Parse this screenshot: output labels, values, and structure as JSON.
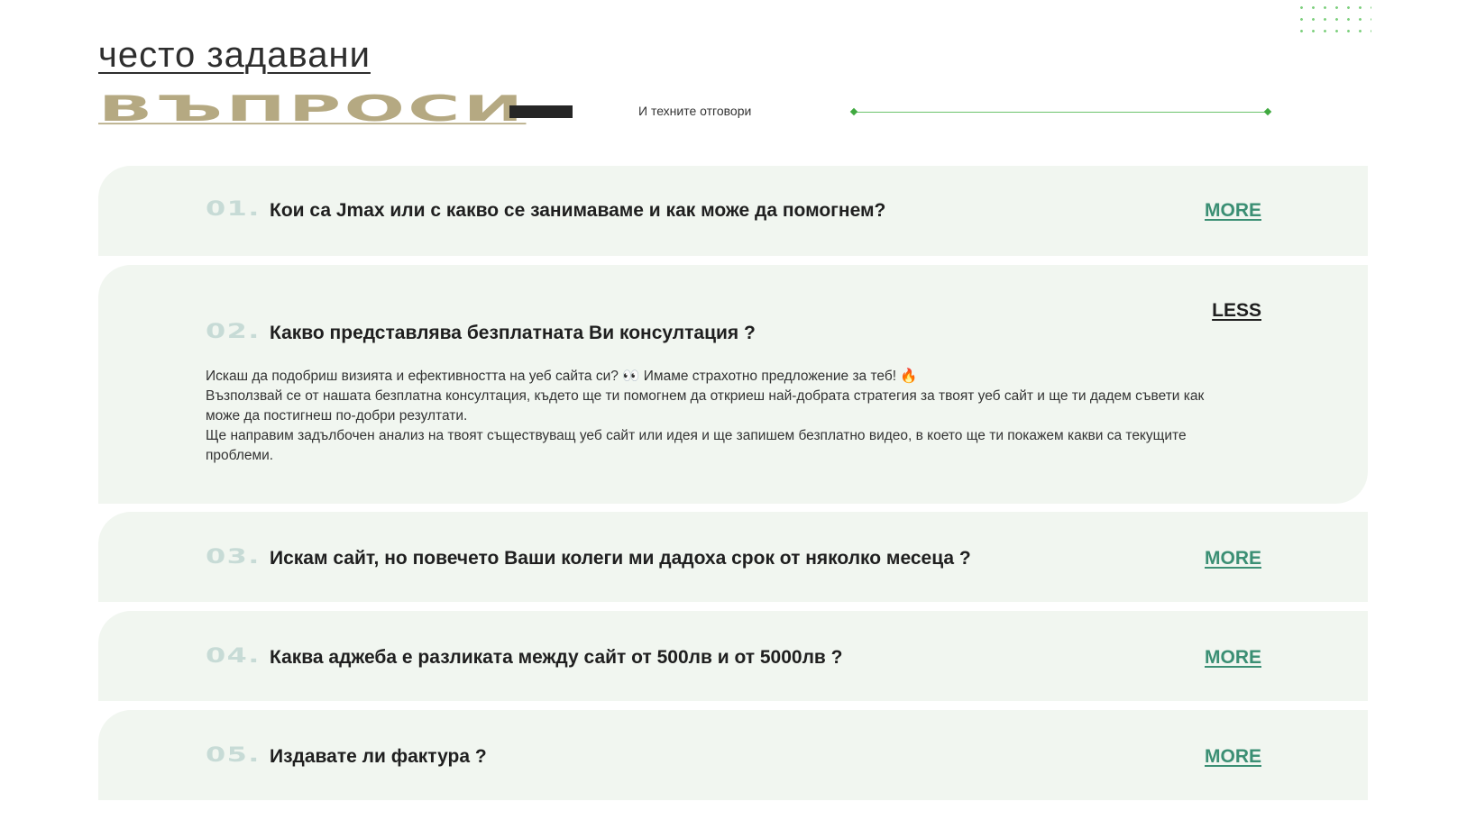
{
  "header": {
    "title_line1": "често задавани",
    "title_line2": "въпроси",
    "subtitle": "И техните отговори"
  },
  "colors": {
    "accent_green": "#6cc36c",
    "title_gold": "#b5a982",
    "card_bg": "#f1f6f0",
    "more_link": "#3b8f74"
  },
  "faq": [
    {
      "number": "01.",
      "question": "Кои са Jmax или с какво се занимаваме и как може да помогнем?",
      "toggle": "MORE"
    },
    {
      "number": "02.",
      "question": "Какво представлява безплатната Ви консултация ?",
      "toggle": "LESS",
      "answer": [
        "Искаш да подобриш визията и ефективността на уеб сайта си? 👀 Имаме страхотно предложение за теб! 🔥",
        "Възползвай се от нашата безплатна консултация, където ще ти помогнем да откриеш най-добрата стратегия за твоят уеб сайт и ще ти дадем съвети как може да постигнеш по-добри резултати.",
        "Ще направим задълбочен анализ на твоят съществуващ уеб сайт или идея и ще запишем безплатно видео, в което ще ти покажем какви са текущите проблеми."
      ]
    },
    {
      "number": "03.",
      "question": "Искам сайт, но повечето Ваши колеги ми дадоха срок от няколко месеца ?",
      "toggle": "MORE"
    },
    {
      "number": "04.",
      "question": "Каква аджеба е разликата между сайт от 500лв и от 5000лв ?",
      "toggle": "MORE"
    },
    {
      "number": "05.",
      "question": "Издавате ли фактура ?",
      "toggle": "MORE"
    }
  ]
}
